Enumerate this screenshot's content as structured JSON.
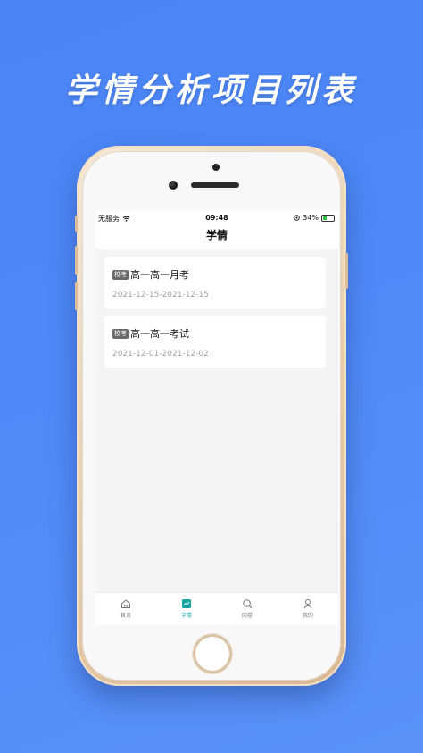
{
  "headline": "学情分析项目列表",
  "status_bar": {
    "carrier": "无服务",
    "time": "09:48",
    "battery": "34%",
    "battery_level": 0.34
  },
  "nav": {
    "title": "学情"
  },
  "exams": [
    {
      "badge": "校考",
      "title": "高一高一月考",
      "date": "2021-12-15-2021-12-15"
    },
    {
      "badge": "校考",
      "title": "高一高一考试",
      "date": "2021-12-01-2021-12-02"
    }
  ],
  "tab_bar": {
    "items": [
      {
        "label": "首页",
        "icon": "home-icon",
        "active": false
      },
      {
        "label": "学情",
        "icon": "chart-icon",
        "active": true
      },
      {
        "label": "阅卷",
        "icon": "search-icon",
        "active": false
      },
      {
        "label": "我的",
        "icon": "user-icon",
        "active": false
      }
    ]
  },
  "colors": {
    "background": "#4f89f7",
    "accent": "#1aa3a3",
    "badge": "#6b6b6b",
    "date_text": "#a3a3a3"
  }
}
